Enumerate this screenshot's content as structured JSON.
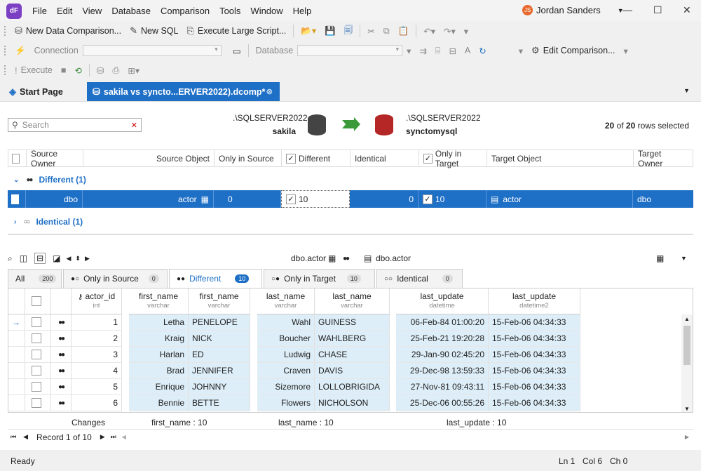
{
  "app": {
    "logo_text": "dF",
    "user_initials": "JS",
    "user_name": "Jordan Sanders"
  },
  "menu": [
    "File",
    "Edit",
    "View",
    "Database",
    "Comparison",
    "Tools",
    "Window",
    "Help"
  ],
  "toolbar1": {
    "new_data_comparison": "New Data Comparison...",
    "new_sql": "New SQL",
    "execute_large_script": "Execute Large Script..."
  },
  "toolbar2": {
    "connection": "Connection",
    "database": "Database",
    "edit_comparison": "Edit Comparison..."
  },
  "toolbar3": {
    "execute": "Execute"
  },
  "tabs": {
    "start_page": "Start Page",
    "doc": "sakila vs syncto...ERVER2022).dcomp*"
  },
  "search": {
    "placeholder": "Search"
  },
  "source": {
    "server": ".\\SQLSERVER2022",
    "db": "sakila"
  },
  "target": {
    "server": ".\\SQLSERVER2022",
    "db": "synctomysql"
  },
  "selection": {
    "count_bold": "20",
    "of": "of",
    "total_bold": "20",
    "suffix": "rows selected"
  },
  "grid_headers": {
    "source_owner": "Source Owner",
    "source_object": "Source Object",
    "only_in_source": "Only in Source",
    "different": "Different",
    "identical": "Identical",
    "only_in_target": "Only in Target",
    "target_object": "Target Object",
    "target_owner": "Target Owner"
  },
  "groups": {
    "different": "Different (1)",
    "identical": "Identical (1)"
  },
  "row": {
    "source_owner": "dbo",
    "source_object": "actor",
    "only_in_source": "0",
    "different": "10",
    "identical": "0",
    "only_in_target": "10",
    "target_object": "actor",
    "target_owner": "dbo"
  },
  "detail": {
    "left_table": "dbo.actor",
    "right_table": "dbo.actor"
  },
  "filter_tabs": [
    {
      "label": "All",
      "count": "200"
    },
    {
      "label": "Only in Source",
      "count": "0"
    },
    {
      "label": "Different",
      "count": "10"
    },
    {
      "label": "Only in Target",
      "count": "10"
    },
    {
      "label": "Identical",
      "count": "0"
    }
  ],
  "columns": [
    {
      "name": "actor_id",
      "type": "int"
    },
    {
      "name": "first_name",
      "type": "varchar"
    },
    {
      "name": "first_name",
      "type": "varchar"
    },
    {
      "name": "last_name",
      "type": "varchar"
    },
    {
      "name": "last_name",
      "type": "varchar"
    },
    {
      "name": "last_update",
      "type": "datetime"
    },
    {
      "name": "last_update",
      "type": "datetime2"
    }
  ],
  "rows": [
    {
      "id": "1",
      "fn_s": "Letha",
      "fn_t": "PENELOPE",
      "ln_s": "Wahl",
      "ln_t": "GUINESS",
      "lu_s": "06-Feb-84 01:00:20",
      "lu_t": "15-Feb-06 04:34:33"
    },
    {
      "id": "2",
      "fn_s": "Kraig",
      "fn_t": "NICK",
      "ln_s": "Boucher",
      "ln_t": "WAHLBERG",
      "lu_s": "25-Feb-21 19:20:28",
      "lu_t": "15-Feb-06 04:34:33"
    },
    {
      "id": "3",
      "fn_s": "Harlan",
      "fn_t": "ED",
      "ln_s": "Ludwig",
      "ln_t": "CHASE",
      "lu_s": "29-Jan-90 02:45:20",
      "lu_t": "15-Feb-06 04:34:33"
    },
    {
      "id": "4",
      "fn_s": "Brad",
      "fn_t": "JENNIFER",
      "ln_s": "Craven",
      "ln_t": "DAVIS",
      "lu_s": "29-Dec-98 13:59:33",
      "lu_t": "15-Feb-06 04:34:33"
    },
    {
      "id": "5",
      "fn_s": "Enrique",
      "fn_t": "JOHNNY",
      "ln_s": "Sizemore",
      "ln_t": "LOLLOBRIGIDA",
      "lu_s": "27-Nov-81 09:43:11",
      "lu_t": "15-Feb-06 04:34:33"
    },
    {
      "id": "6",
      "fn_s": "Bennie",
      "fn_t": "BETTE",
      "ln_s": "Flowers",
      "ln_t": "NICHOLSON",
      "lu_s": "25-Dec-06 00:55:26",
      "lu_t": "15-Feb-06 04:34:33"
    }
  ],
  "summary": {
    "changes": "Changes",
    "first_name": "first_name : 10",
    "last_name": "last_name : 10",
    "last_update": "last_update : 10"
  },
  "navigator": {
    "record": "Record 1 of 10"
  },
  "status": {
    "ready": "Ready",
    "ln": "Ln 1",
    "col": "Col 6",
    "ch": "Ch 0"
  }
}
